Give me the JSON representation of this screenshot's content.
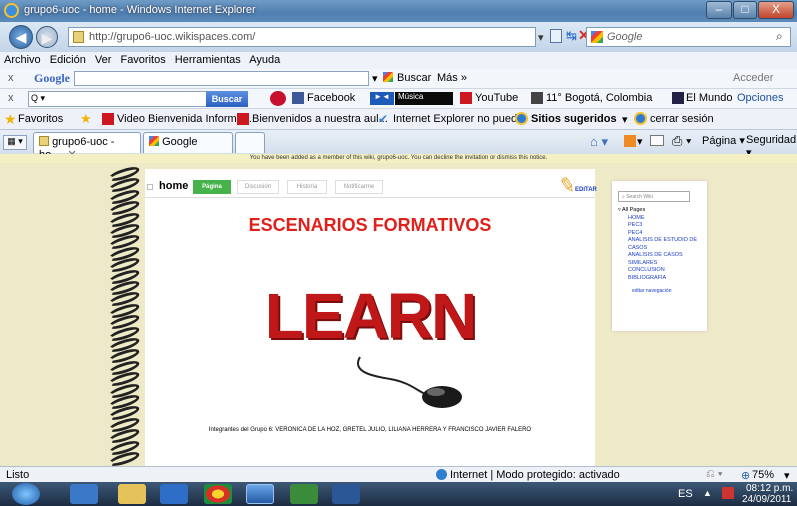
{
  "window": {
    "title": "grupo6-uoc - home - Windows Internet Explorer",
    "min": "–",
    "max": "□",
    "close": "X"
  },
  "address": {
    "url": "http://grupo6-uoc.wikispaces.com/",
    "search_placeholder": "Google",
    "back": "◀",
    "forward": "▶"
  },
  "menu": [
    "Archivo",
    "Edición",
    "Ver",
    "Favoritos",
    "Herramientas",
    "Ayuda"
  ],
  "googlebar": {
    "close": "x",
    "logo": "Google",
    "buscar": "Buscar",
    "mas": "Más »",
    "acceder": "Acceder"
  },
  "toolbar2": {
    "close": "x",
    "buscar": "Buscar",
    "facebook": "Facebook",
    "musica": "Música",
    "youtube": "YouTube",
    "weather": "11° Bogotá, Colombia",
    "mundo": "El Mundo",
    "opciones": "Opciones"
  },
  "favorites": {
    "label": "Favoritos",
    "items": [
      "Video Bienvenida Informá...",
      "Bienvenidos a nuestra aul...",
      "Internet Explorer no pued...",
      "Sitios sugeridos",
      "cerrar sesión"
    ]
  },
  "tabs": [
    {
      "label": "grupo6-uoc - ho..."
    },
    {
      "label": "Google"
    }
  ],
  "commandbar": {
    "pagina": "Página",
    "seguridad": "Seguridad"
  },
  "infobar": {
    "text": "You have been added as a member of this wiki, grupo6-uoc. You can decline the invitation or dismiss this notice."
  },
  "wiki": {
    "page_name": "home",
    "tabs": [
      "Página",
      "Discusión",
      "Historia",
      "Notifícarme"
    ],
    "edit": "EDITAR",
    "heading": "ESCENARIOS FORMATIVOS",
    "image_word": "LEARN",
    "footer": "Integrantes del Grupo 6: VERONICA DE LA HOZ, GRETEL JULIO, LILIANA HERRERA Y FRANCISCO JAVIER FALERO",
    "search_placeholder": "Search Wiki",
    "all_pages": "All Pages",
    "pages": [
      "HOME",
      "PEC3",
      "PEC4",
      "ANALISIS DE ESTUDIO DE CASOS",
      "ANALISIS DE CASOS SIMILARES",
      "CONCLUSION",
      "BIBLIOGRAFIA"
    ],
    "edit_nav": "editar navegación"
  },
  "status": {
    "left": "Listo",
    "zone": "Internet | Modo protegido: activado",
    "zoom": "75%"
  },
  "taskbar": {
    "lang": "ES",
    "time": "08:12 p.m.",
    "date": "24/09/2011"
  }
}
